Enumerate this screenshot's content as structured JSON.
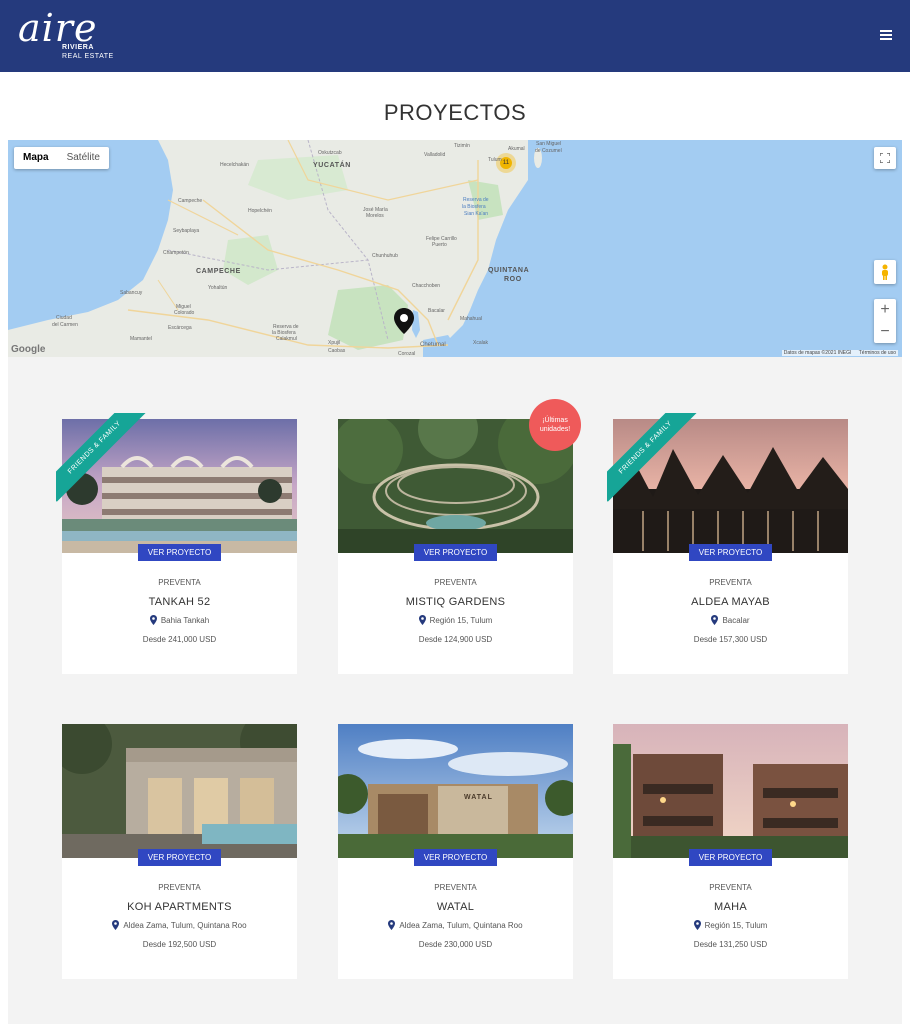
{
  "header": {
    "logo_script": "aire",
    "logo_line1": "RIVIERA",
    "logo_line2": "REAL ESTATE"
  },
  "page": {
    "title": "PROYECTOS"
  },
  "map": {
    "type_map": "Mapa",
    "type_satellite": "Satélite",
    "cluster_count": "11",
    "zoom_in": "+",
    "zoom_out": "−",
    "google": "Google",
    "attribution": "Datos de mapas ©2021 INEGI",
    "terms": "Términos de uso",
    "labels": {
      "yucatan": "YUCATÁN",
      "campeche": "CAMPECHE",
      "quintana_roo_1": "QUINTANA",
      "quintana_roo_2": "ROO",
      "campeche_city": "Campeche",
      "champoton": "Champotón",
      "ciudad_carmen_1": "Ciudad",
      "ciudad_carmen_2": "del Carmen",
      "escarcega": "Escárcega",
      "chetumal": "Chetumal",
      "jose_maria_1": "José María",
      "jose_maria_2": "Morelos",
      "felipe_carrillo_1": "Felipe Carrillo",
      "felipe_carrillo_2": "Puerto",
      "biosfera_1": "Reserva de",
      "biosfera_2": "la Biosfera",
      "biosfera_3": "Sian Ka'an",
      "calakmul_1": "Reserva de",
      "calakmul_2": "la Biosfera",
      "calakmul_3": "Calakmul",
      "san_miguel_1": "San Miguel",
      "san_miguel_2": "de Cozumel",
      "hopelchen": "Hopelchén",
      "xpujil": "Xpujil",
      "oxkutzcab": "Oxkutzcab",
      "bacalar": "Bacalar",
      "tulum": "Tulum",
      "mahahual": "Mahahual",
      "chacchoben": "Chacchoben",
      "akumal": "Akumal",
      "corozal": "Corozal",
      "caobas": "Caobas",
      "mamantel": "Mamantel",
      "sabancuy": "Sabancuy",
      "hecelchakan": "Hecelchakán",
      "chunhuhub": "Chunhuhub",
      "miguel_colorado_1": "Miguel",
      "miguel_colorado_2": "Colorado",
      "yohaltun": "Yohaltún",
      "xcalak": "Xcalak",
      "seybaplaya": "Seybaplaya",
      "valladolid": "Valladolid",
      "tizimin": "Tizimín"
    }
  },
  "projects": [
    {
      "status": "PREVENTA",
      "name": "TANKAH 52",
      "location": "Bahia Tankah",
      "price": "Desde 241,000 USD",
      "cta": "VER PROYECTO",
      "ribbon": "FRIENDS & FAMILY"
    },
    {
      "status": "PREVENTA",
      "name": "MISTIQ GARDENS",
      "location": "Región 15, Tulum",
      "price": "Desde 124,900 USD",
      "cta": "VER PROYECTO",
      "badge": "¡Últimas unidades!"
    },
    {
      "status": "PREVENTA",
      "name": "ALDEA MAYAB",
      "location": "Bacalar",
      "price": "Desde 157,300 USD",
      "cta": "VER PROYECTO",
      "ribbon": "FRIENDS & FAMILY"
    },
    {
      "status": "PREVENTA",
      "name": "KOH APARTMENTS",
      "location": "Aldea Zama, Tulum, Quintana Roo",
      "price": "Desde 192,500 USD",
      "cta": "VER PROYECTO"
    },
    {
      "status": "PREVENTA",
      "name": "WATAL",
      "location": "Aldea Zama, Tulum, Quintana Roo",
      "price": "Desde 230,000 USD",
      "cta": "VER PROYECTO",
      "sign": "WATAL"
    },
    {
      "status": "PREVENTA",
      "name": "MAHA",
      "location": "Región 15, Tulum",
      "price": "Desde 131,250 USD",
      "cta": "VER PROYECTO"
    }
  ],
  "colors": {
    "header": "#253a7d",
    "cta": "#3047c2",
    "ribbon": "#16a597",
    "badge": "#ef5a5a",
    "map_water": "#a3ccf2",
    "map_land": "#e8eae4"
  },
  "icons": [
    "menu-icon",
    "fullscreen-icon",
    "pegman-icon",
    "map-pin-icon",
    "location-pin-icon"
  ]
}
